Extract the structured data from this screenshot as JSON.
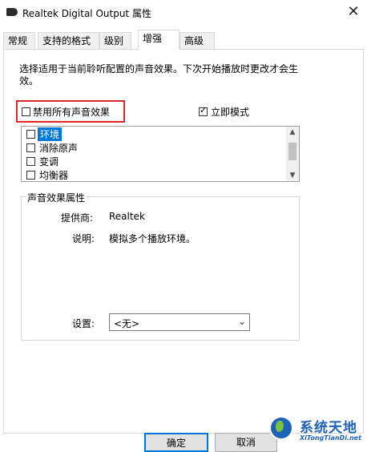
{
  "window": {
    "title": "Realtek Digital Output 属性",
    "close_glyph": "✕"
  },
  "tabs": [
    {
      "label": "常规"
    },
    {
      "label": "支持的格式"
    },
    {
      "label": "级别"
    },
    {
      "label": "增强",
      "active": true
    },
    {
      "label": "高级"
    }
  ],
  "enhancements": {
    "description": "选择适用于当前聆听配置的声音效果。下次开始播放时更改才会生效。",
    "disable_all_label": "禁用所有声音效果",
    "disable_all_checked": false,
    "immediate_mode_label": "立即模式",
    "immediate_mode_checked": true,
    "items": [
      {
        "label": "环境",
        "checked": false,
        "selected": true
      },
      {
        "label": "消除原声",
        "checked": false,
        "selected": false
      },
      {
        "label": "变调",
        "checked": false,
        "selected": false
      },
      {
        "label": "均衡器",
        "checked": false,
        "selected": false
      }
    ]
  },
  "properties": {
    "group_title": "声音效果属性",
    "provider_label": "提供商:",
    "provider_value": "Realtek",
    "description_label": "说明:",
    "description_value": "模拟多个播放环境。",
    "settings_label": "设置:",
    "settings_value": "<无>"
  },
  "buttons": {
    "ok": "确定",
    "cancel": "取消"
  },
  "watermark": {
    "main": "系统天地",
    "sub": "XiTongTianDi.net"
  },
  "colors": {
    "highlight_box": "#e0242b",
    "selection": "#0078d7"
  }
}
